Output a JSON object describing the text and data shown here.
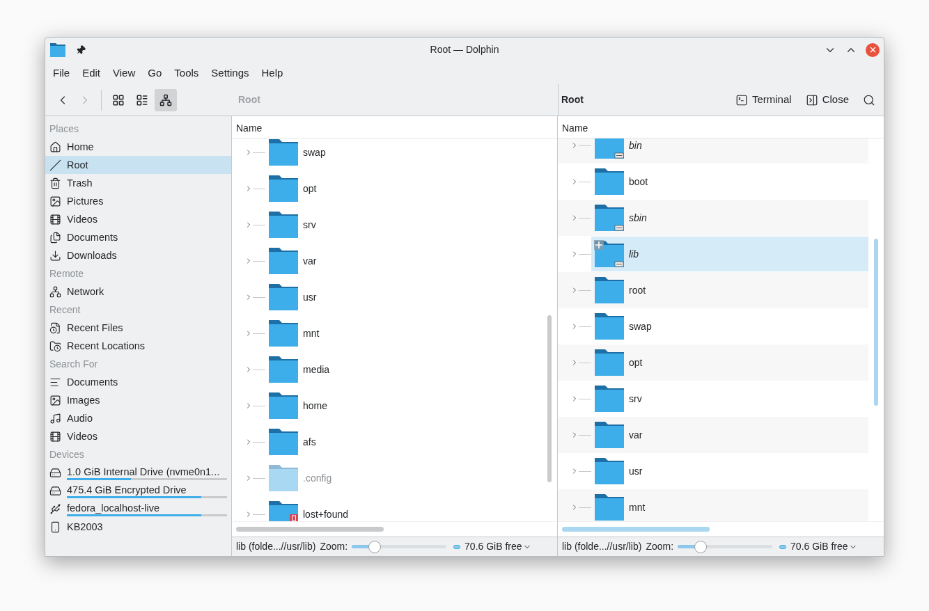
{
  "window": {
    "title": "Root — Dolphin"
  },
  "menu": [
    "File",
    "Edit",
    "View",
    "Go",
    "Tools",
    "Settings",
    "Help"
  ],
  "toolbar": {
    "back": {
      "disabled": false
    },
    "forward": {
      "disabled": true
    },
    "view_modes": [
      {
        "selected": false
      },
      {
        "selected": false
      },
      {
        "selected": true
      }
    ]
  },
  "sidebar": {
    "sections": [
      {
        "title": "Places",
        "items": [
          {
            "label": "Home",
            "kind": "home",
            "selected": false
          },
          {
            "label": "Root",
            "kind": "root",
            "selected": true
          },
          {
            "label": "Trash",
            "kind": "trash",
            "selected": false
          },
          {
            "label": "Pictures",
            "kind": "image",
            "selected": false
          },
          {
            "label": "Videos",
            "kind": "film",
            "selected": false
          },
          {
            "label": "Documents",
            "kind": "document",
            "selected": false
          },
          {
            "label": "Downloads",
            "kind": "download",
            "selected": false
          }
        ]
      },
      {
        "title": "Remote",
        "items": [
          {
            "label": "Network",
            "kind": "network",
            "selected": false
          }
        ]
      },
      {
        "title": "Recent",
        "items": [
          {
            "label": "Recent Files",
            "kind": "recent-file",
            "selected": false
          },
          {
            "label": "Recent Locations",
            "kind": "recent-folder",
            "selected": false
          }
        ]
      },
      {
        "title": "Search For",
        "items": [
          {
            "label": "Documents",
            "kind": "lines",
            "selected": false
          },
          {
            "label": "Images",
            "kind": "image",
            "selected": false
          },
          {
            "label": "Audio",
            "kind": "music",
            "selected": false
          },
          {
            "label": "Videos",
            "kind": "film",
            "selected": false
          }
        ]
      },
      {
        "title": "Devices",
        "items": [
          {
            "label": "1.0 GiB Internal Drive (nvme0n1...",
            "kind": "drive",
            "selected": false,
            "level": 0.4
          },
          {
            "label": "475.4 GiB Encrypted Drive",
            "kind": "encrypted-drive",
            "selected": false,
            "level": 0.84
          },
          {
            "label": "fedora_localhost-live",
            "kind": "usb-drive",
            "selected": false,
            "level": 0.84
          },
          {
            "label": "KB2003",
            "kind": "phone",
            "selected": false
          }
        ]
      }
    ]
  },
  "panes": [
    {
      "location": "Root",
      "active": false,
      "column": "Name",
      "items": [
        {
          "name": "swap",
          "symlink": false,
          "hidden": false,
          "locked": false,
          "selected": false
        },
        {
          "name": "opt",
          "symlink": false,
          "hidden": false,
          "locked": false,
          "selected": false
        },
        {
          "name": "srv",
          "symlink": false,
          "hidden": false,
          "locked": false,
          "selected": false
        },
        {
          "name": "var",
          "symlink": false,
          "hidden": false,
          "locked": false,
          "selected": false
        },
        {
          "name": "usr",
          "symlink": false,
          "hidden": false,
          "locked": false,
          "selected": false
        },
        {
          "name": "mnt",
          "symlink": false,
          "hidden": false,
          "locked": false,
          "selected": false
        },
        {
          "name": "media",
          "symlink": false,
          "hidden": false,
          "locked": false,
          "selected": false
        },
        {
          "name": "home",
          "symlink": false,
          "hidden": false,
          "locked": false,
          "selected": false
        },
        {
          "name": "afs",
          "symlink": false,
          "hidden": false,
          "locked": false,
          "selected": false
        },
        {
          "name": ".config",
          "symlink": false,
          "hidden": true,
          "locked": false,
          "selected": false
        },
        {
          "name": "lost+found",
          "symlink": false,
          "hidden": false,
          "locked": true,
          "selected": false
        }
      ],
      "status": {
        "text": "lib (folde...//usr/lib)",
        "zoom_label": "Zoom:",
        "zoom": {
          "level": 0.24
        },
        "free": "70.6 GiB free"
      }
    },
    {
      "location": "Root",
      "active": true,
      "actions": [
        {
          "label": "Terminal",
          "kind": "terminal"
        },
        {
          "label": "Close",
          "kind": "close-pane"
        }
      ],
      "column": "Name",
      "items": [
        {
          "name": "bin",
          "symlink": true,
          "hidden": false,
          "locked": false,
          "selected": false
        },
        {
          "name": "boot",
          "symlink": false,
          "hidden": false,
          "locked": false,
          "selected": false
        },
        {
          "name": "sbin",
          "symlink": true,
          "hidden": false,
          "locked": false,
          "selected": false
        },
        {
          "name": "lib",
          "symlink": true,
          "hidden": false,
          "locked": false,
          "selected": true
        },
        {
          "name": "root",
          "symlink": false,
          "hidden": false,
          "locked": false,
          "selected": false
        },
        {
          "name": "swap",
          "symlink": false,
          "hidden": false,
          "locked": false,
          "selected": false
        },
        {
          "name": "opt",
          "symlink": false,
          "hidden": false,
          "locked": false,
          "selected": false
        },
        {
          "name": "srv",
          "symlink": false,
          "hidden": false,
          "locked": false,
          "selected": false
        },
        {
          "name": "var",
          "symlink": false,
          "hidden": false,
          "locked": false,
          "selected": false
        },
        {
          "name": "usr",
          "symlink": false,
          "hidden": false,
          "locked": false,
          "selected": false
        },
        {
          "name": "mnt",
          "symlink": false,
          "hidden": false,
          "locked": false,
          "selected": false
        }
      ],
      "status": {
        "text": "lib (folde...//usr/lib)",
        "zoom_label": "Zoom:",
        "zoom": {
          "level": 0.24
        },
        "free": "70.6 GiB free"
      }
    }
  ]
}
